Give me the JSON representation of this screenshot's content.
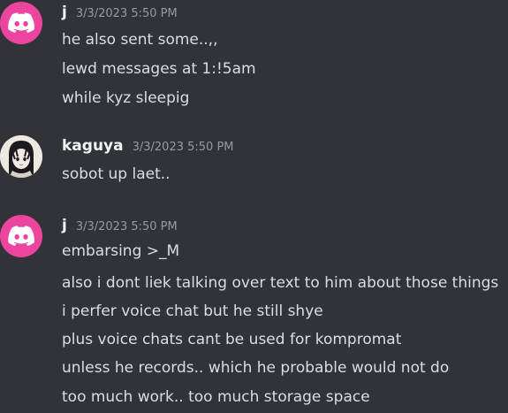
{
  "messages": [
    {
      "author": "j",
      "timestamp": "3/3/2023 5:50 PM",
      "avatar_icon": "discord-logo-icon",
      "avatar_color": "#eb459e",
      "lines": [
        "he also sent some..,,",
        "lewd messages at 1:!5am",
        "while kyz sleepig"
      ]
    },
    {
      "author": "kaguya",
      "timestamp": "3/3/2023 5:50 PM",
      "avatar_icon": "anime-girl-avatar-icon",
      "lines": [
        "sobot up laet.."
      ]
    },
    {
      "author": "j",
      "timestamp": "3/3/2023 5:50 PM",
      "avatar_icon": "discord-logo-icon",
      "avatar_color": "#eb459e",
      "lines": [
        "embarsing >_M",
        "also i dont liek talking over text to him about those things",
        "i perfer voice chat but he still shye",
        "plus voice chats cant be used for kompromat",
        "unless he records.. which he probable would not do",
        "too much work.. too much storage space"
      ]
    }
  ]
}
